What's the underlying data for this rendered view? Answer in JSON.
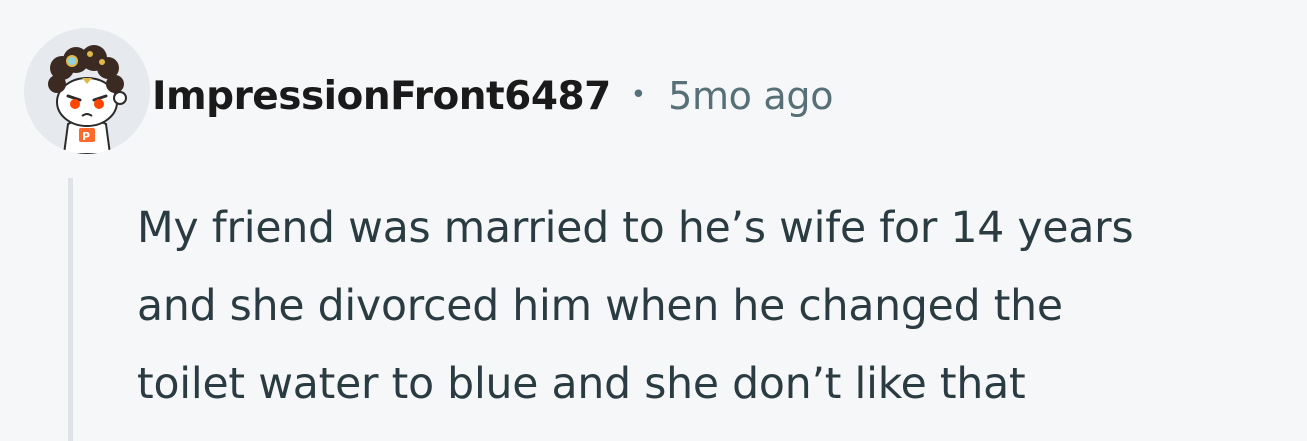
{
  "comment": {
    "author": "ImpressionFront6487",
    "separator": "•",
    "timestamp": "5mo ago",
    "avatar_icon": "snoo-avatar-icon",
    "body_lines": [
      "My friend was married to he’s wife for 14 years",
      "and she divorced him when he changed the",
      "toilet water to blue and she don’t like that"
    ]
  },
  "colors": {
    "background": "#f6f7f9",
    "author": "#1a1a1b",
    "meta": "#576f76",
    "body_text": "#2a3c42",
    "thread_line": "#dfe3e7"
  }
}
